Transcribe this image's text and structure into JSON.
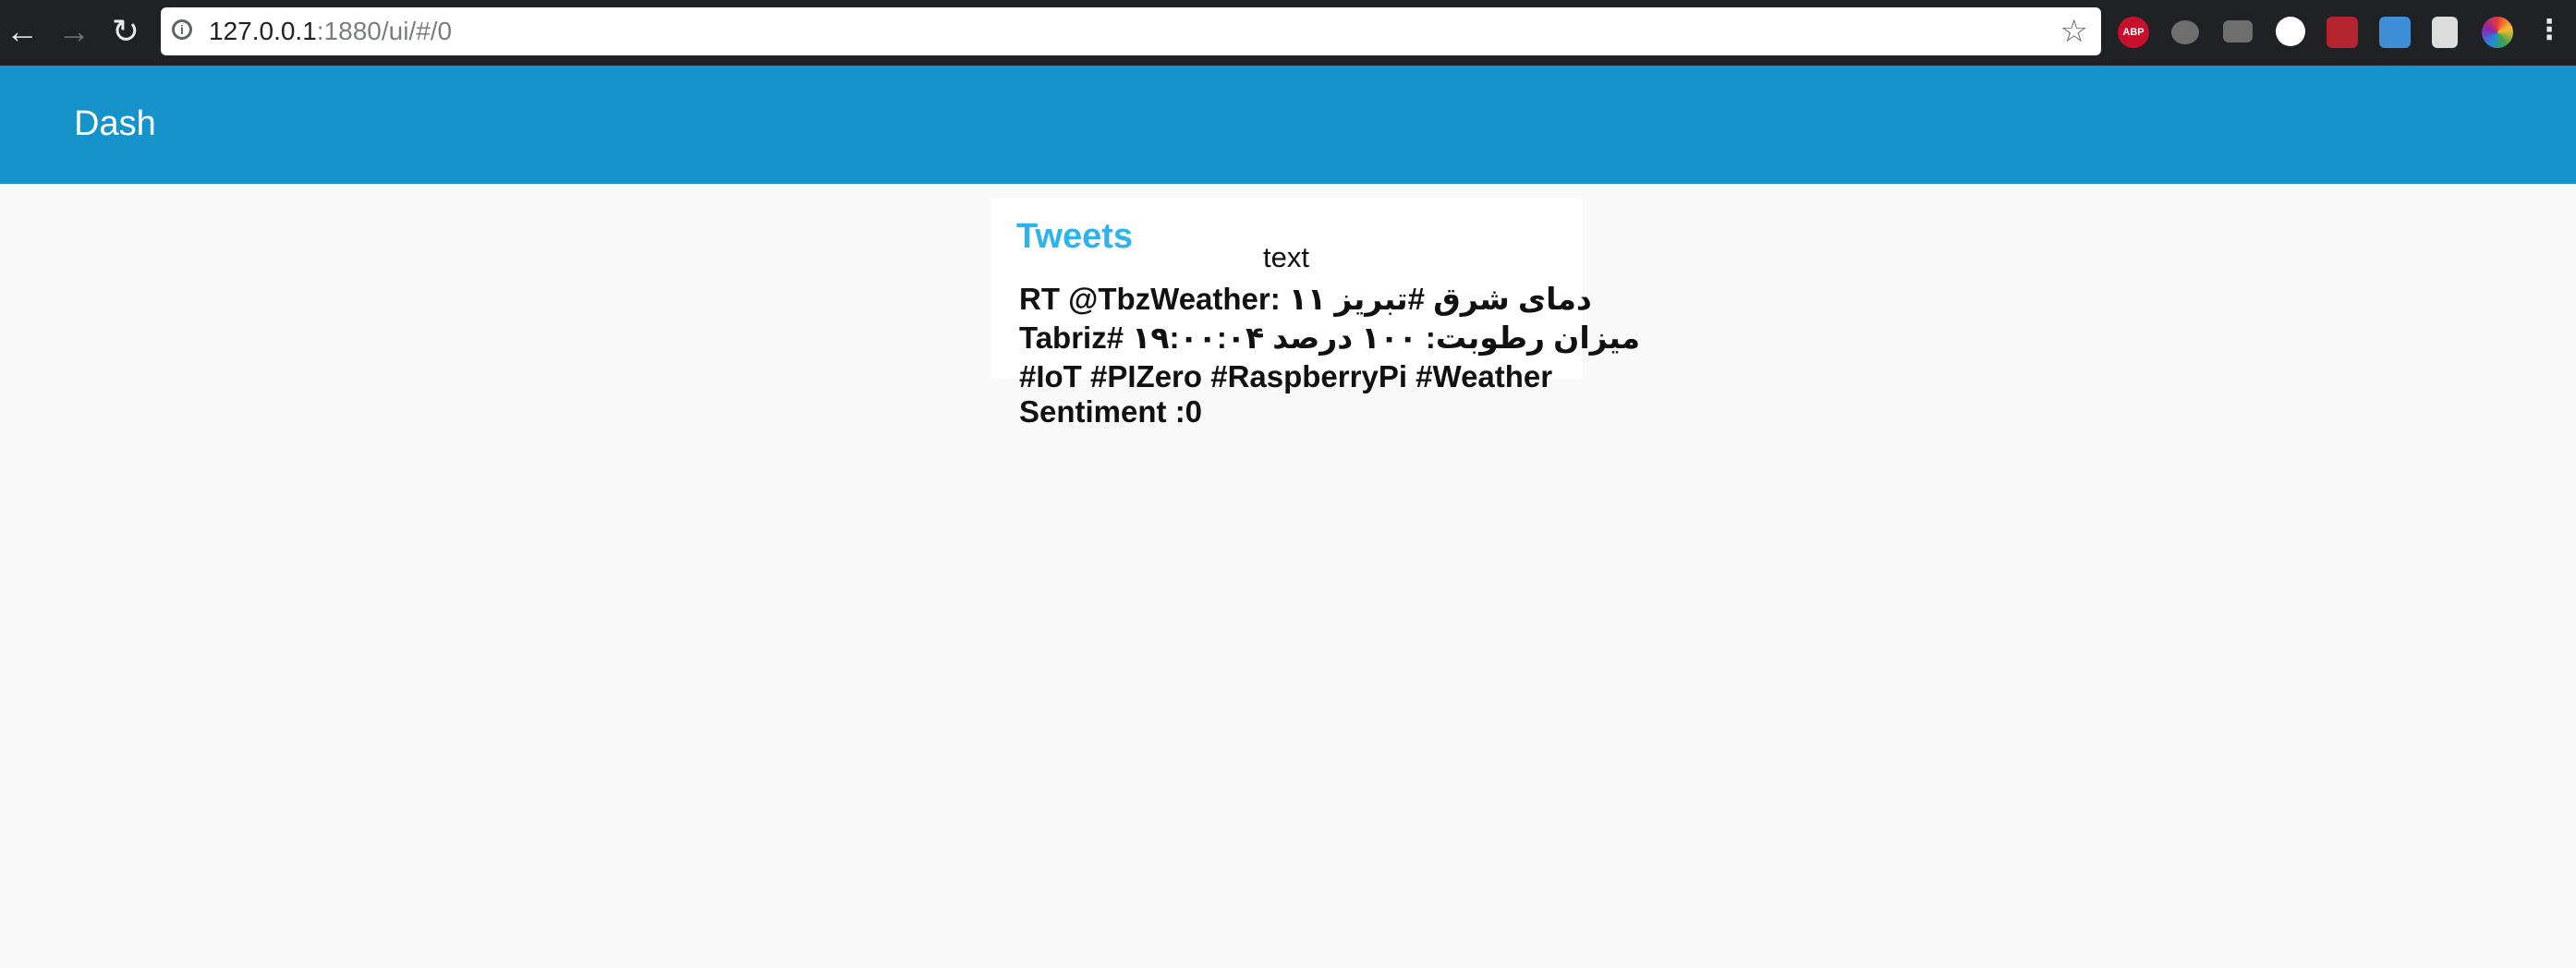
{
  "browser": {
    "back_icon": "←",
    "forward_icon": "→",
    "reload_icon": "↻",
    "url_host": "127.0.0.1",
    "url_rest": ":1880/ui/#/0",
    "info_icon": "i",
    "star_icon": "☆",
    "extensions": [
      "adblock-icon",
      "chat-icon",
      "folder-icon",
      "circle-icon",
      "mendeley-icon",
      "download-icon",
      "document-icon",
      "color-wheel-icon",
      "menu-dots-icon"
    ],
    "abp_label": "ABP"
  },
  "app": {
    "title": "Dash"
  },
  "tweets_widget": {
    "title": "Tweets",
    "label": "text",
    "tweet_lines": [
      "RT @TbzWeather: ۱۱ دمای شرق #تبریز",
      "Tabriz# میزان رطوبت: ۱۰۰ درصد ۱۹:۰۰:۰۴",
      "#IoT #PIZero #RaspberryPi #Weather",
      "Sentiment :0"
    ]
  },
  "colors": {
    "header": "#1693cb",
    "title_accent": "#2db5eb",
    "background": "#f9f9f9"
  }
}
